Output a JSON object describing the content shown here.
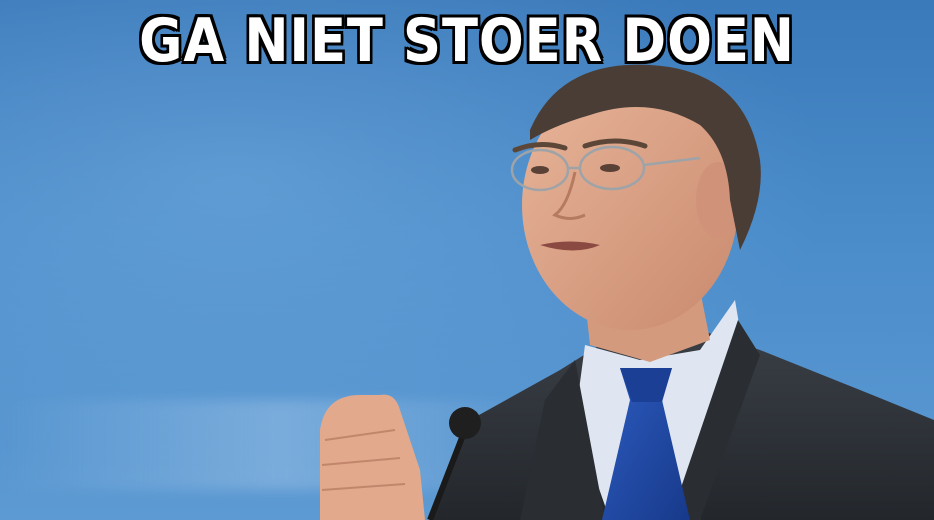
{
  "meme": {
    "caption": "GA NIET STOER DOEN"
  },
  "colors": {
    "background": "#3f82c4",
    "caption_fill": "#ffffff",
    "caption_outline": "#000000",
    "suit": "#2f3338",
    "shirt": "#dfe6f2",
    "tie": "#1f4aa8"
  }
}
